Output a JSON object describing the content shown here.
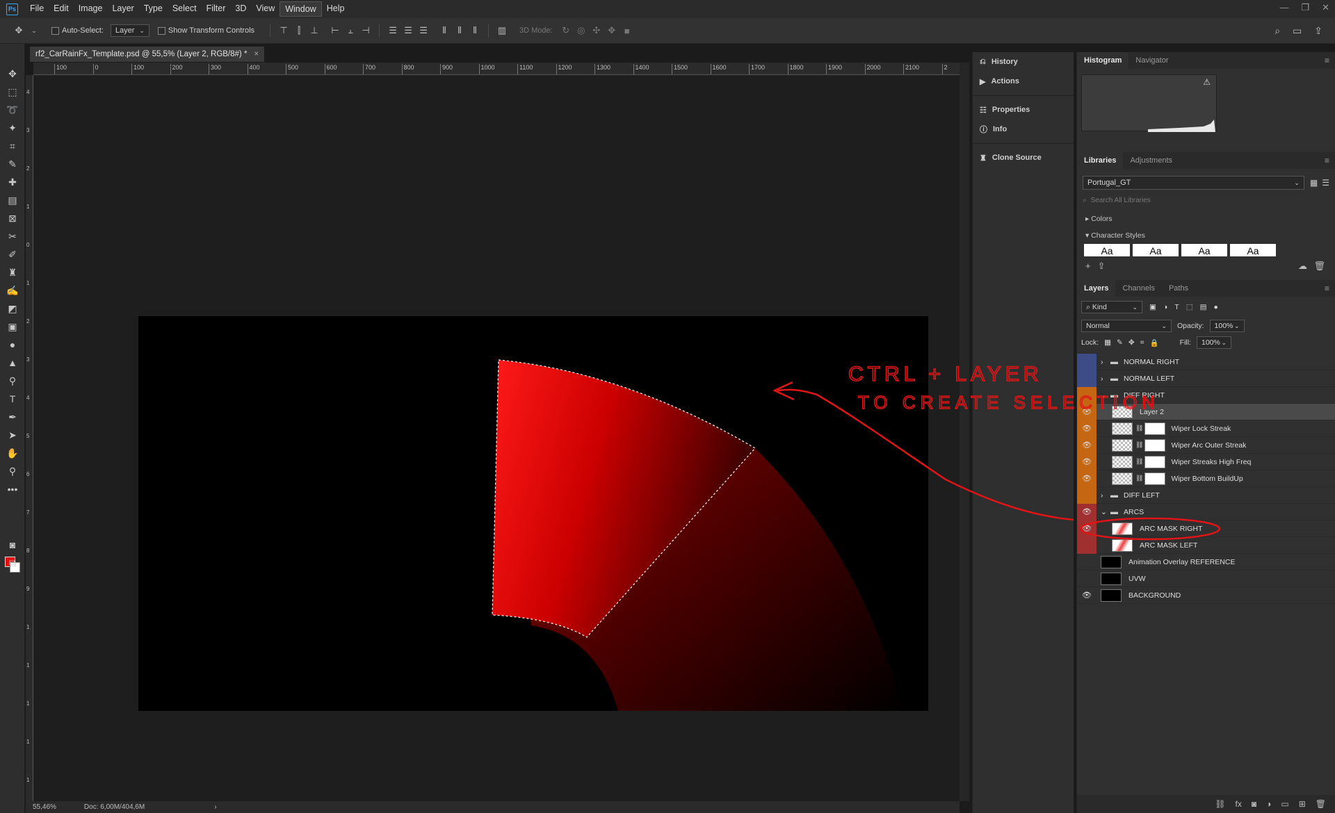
{
  "menu": {
    "logo": "Ps",
    "items": [
      "File",
      "Edit",
      "Image",
      "Layer",
      "Type",
      "Select",
      "Filter",
      "3D",
      "View",
      "Window",
      "Help"
    ],
    "active_index": 9
  },
  "options": {
    "auto_select_label": "Auto-Select:",
    "auto_select_target": "Layer",
    "show_transform_label": "Show Transform Controls",
    "mode_3d_label": "3D Mode:"
  },
  "document": {
    "tab_title": "rf2_CarRainFx_Template.psd @ 55,5% (Layer 2, RGB/8#) *",
    "close": "×",
    "ruler_ticks": [
      "100",
      "0",
      "100",
      "200",
      "300",
      "400",
      "500",
      "600",
      "700",
      "800",
      "900",
      "1000",
      "1100",
      "1200",
      "1300",
      "1400",
      "1500",
      "1600",
      "1700",
      "1800",
      "1900",
      "2000",
      "2100",
      "2"
    ],
    "vruler_ticks": [
      "4",
      "3",
      "2",
      "1",
      "0",
      "1",
      "2",
      "3",
      "4",
      "5",
      "6",
      "7",
      "8",
      "9",
      "1",
      "1",
      "1",
      "1",
      "1"
    ],
    "zoom": "55,46%",
    "doc_size": "Doc: 6,00M/404,6M",
    "status_arrow": "›"
  },
  "dock": {
    "items": [
      {
        "icon": "history-icon",
        "label": "History"
      },
      {
        "icon": "actions-icon",
        "label": "Actions"
      },
      {
        "icon": "properties-icon",
        "label": "Properties"
      },
      {
        "icon": "info-icon",
        "label": "Info"
      },
      {
        "icon": "clone-source-icon",
        "label": "Clone Source"
      }
    ]
  },
  "histogram_panel": {
    "tabs": [
      "Histogram",
      "Navigator"
    ],
    "active": 0,
    "warning": "⚠"
  },
  "libraries_panel": {
    "tabs": [
      "Libraries",
      "Adjustments"
    ],
    "active": 0,
    "library": "Portugal_GT",
    "search_placeholder": "Search All Libraries",
    "sections": [
      "Colors",
      "Character Styles"
    ],
    "char_style_samples": [
      "Aa",
      "Aa",
      "Aa",
      "Aa"
    ]
  },
  "layers_panel": {
    "tabs": [
      "Layers",
      "Channels",
      "Paths"
    ],
    "active": 0,
    "kind": "Kind",
    "blend_mode": "Normal",
    "opacity_label": "Opacity:",
    "opacity": "100%",
    "lock_label": "Lock:",
    "fill_label": "Fill:",
    "fill": "100%",
    "layers": [
      {
        "name": "NORMAL RIGHT",
        "type": "folder",
        "label": "blue",
        "visible": false,
        "indent": 0,
        "expanded": false
      },
      {
        "name": "NORMAL LEFT",
        "type": "folder",
        "label": "blue",
        "visible": false,
        "indent": 0,
        "expanded": false
      },
      {
        "name": "DIFF RIGHT",
        "type": "folder",
        "label": "orange",
        "visible": false,
        "indent": 0,
        "expanded": true
      },
      {
        "name": "Layer 2",
        "type": "layer",
        "label": "orange",
        "visible": true,
        "indent": 1,
        "selected": true
      },
      {
        "name": "Wiper Lock Streak",
        "type": "masked",
        "label": "orange",
        "visible": true,
        "indent": 1
      },
      {
        "name": "Wiper Arc Outer Streak",
        "type": "masked",
        "label": "orange",
        "visible": true,
        "indent": 1
      },
      {
        "name": "Wiper Streaks High Freq",
        "type": "masked",
        "label": "orange",
        "visible": true,
        "indent": 1
      },
      {
        "name": "Wiper Bottom BuildUp",
        "type": "masked",
        "label": "orange",
        "visible": true,
        "indent": 1
      },
      {
        "name": "DIFF LEFT",
        "type": "folder",
        "label": "orange",
        "visible": false,
        "indent": 0,
        "expanded": false
      },
      {
        "name": "ARCS",
        "type": "folder",
        "label": "red",
        "visible": true,
        "indent": 0,
        "expanded": true
      },
      {
        "name": "ARC MASK RIGHT",
        "type": "layer",
        "label": "red",
        "visible": true,
        "indent": 1
      },
      {
        "name": "ARC MASK LEFT",
        "type": "layer",
        "label": "red",
        "visible": false,
        "indent": 1
      },
      {
        "name": "Animation Overlay REFERENCE",
        "type": "layer",
        "label": "none",
        "visible": false,
        "indent": 0
      },
      {
        "name": "UVW",
        "type": "layer",
        "label": "none",
        "visible": false,
        "indent": 0
      },
      {
        "name": "BACKGROUND",
        "type": "layer",
        "label": "none",
        "visible": true,
        "indent": 0
      }
    ],
    "footer_icons": [
      "link-icon",
      "fx-icon",
      "mask-icon",
      "adjustment-icon",
      "folder-icon",
      "new-layer-icon",
      "trash-icon"
    ]
  },
  "annotation": {
    "line1": "CTRL + LAYER",
    "line2": "TO CREATE SELECTION",
    "color": "#e01515"
  },
  "colors": {
    "foreground": "#e01010",
    "background": "#ffffff",
    "label_blue": "#3d4b86",
    "label_orange": "#c56712",
    "label_red": "#a02f2f"
  }
}
